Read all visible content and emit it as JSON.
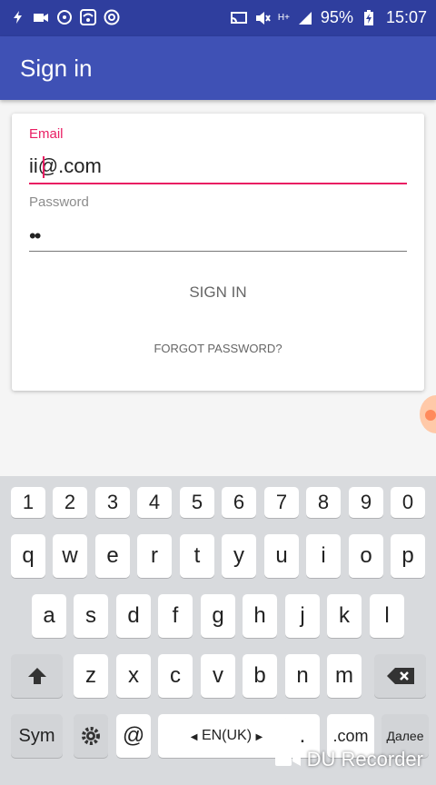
{
  "status_bar": {
    "battery": "95%",
    "time": "15:07",
    "hplus": "H+"
  },
  "app_bar": {
    "title": "Sign in"
  },
  "form": {
    "email_label": "Email",
    "email_value": "ii@.com",
    "password_label": "Password",
    "password_value": "••",
    "signin_label": "SIGN IN",
    "forgot_label": "FORGOT PASSWORD?"
  },
  "keyboard": {
    "row_numbers": [
      "1",
      "2",
      "3",
      "4",
      "5",
      "6",
      "7",
      "8",
      "9",
      "0"
    ],
    "row_q": [
      "q",
      "w",
      "e",
      "r",
      "t",
      "y",
      "u",
      "i",
      "o",
      "p"
    ],
    "row_a": [
      "a",
      "s",
      "d",
      "f",
      "g",
      "h",
      "j",
      "k",
      "l"
    ],
    "row_z": [
      "z",
      "x",
      "c",
      "v",
      "b",
      "n",
      "m"
    ],
    "sym": "Sym",
    "at": "@",
    "lang": "EN(UK)",
    "dot": ".",
    "dotcom": ".com",
    "next": "Далее"
  },
  "watermark": {
    "text": "DU Recorder"
  }
}
